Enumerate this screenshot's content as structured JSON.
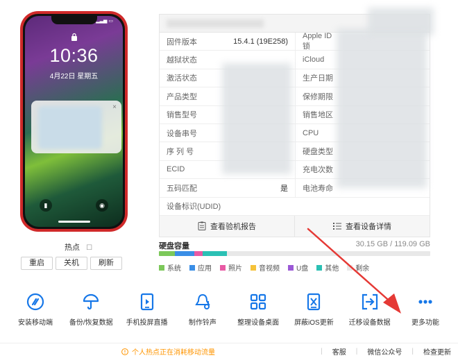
{
  "phone": {
    "time": "10:36",
    "date": "4月22日 星期五",
    "hotspot_label": "热点",
    "buttons": [
      "重启",
      "关机",
      "刷新"
    ]
  },
  "info": {
    "rows": [
      {
        "l1": "固件版本",
        "v1": "15.4.1 (19E258)",
        "l2": "Apple ID锁"
      },
      {
        "l1": "越狱状态",
        "v1": "",
        "l2": "iCloud"
      },
      {
        "l1": "激活状态",
        "v1": "",
        "l2": "生产日期"
      },
      {
        "l1": "产品类型",
        "v1": "",
        "l2": "保修期限"
      },
      {
        "l1": "销售型号",
        "v1": "",
        "l2": "销售地区"
      },
      {
        "l1": "设备串号",
        "v1": "",
        "l2": "CPU"
      },
      {
        "l1": "序 列 号",
        "v1": "",
        "l2": "硬盘类型"
      },
      {
        "l1": "ECID",
        "v1": "",
        "l2": "充电次数"
      },
      {
        "l1": "五码匹配",
        "v1": "是",
        "l2": "电池寿命"
      }
    ],
    "udid_label": "设备标识(UDID)",
    "report_btn": "查看验机报告",
    "detail_btn": "查看设备详情"
  },
  "disk": {
    "title": "硬盘容量",
    "size": "30.15 GB / 119.09 GB",
    "segments": [
      {
        "name": "系统",
        "color": "#7cc85a",
        "fraction": 0.06
      },
      {
        "name": "应用",
        "color": "#3a8ee6",
        "fraction": 0.07
      },
      {
        "name": "照片",
        "color": "#e85aa4",
        "fraction": 0.03
      },
      {
        "name": "音视频",
        "color": "#f5c23a",
        "fraction": 0.0
      },
      {
        "name": "U盘",
        "color": "#9b59d6",
        "fraction": 0.0
      },
      {
        "name": "其他",
        "color": "#2bc0b4",
        "fraction": 0.09
      },
      {
        "name": "剩余",
        "color": "#e8e8e8",
        "fraction": 0.75
      }
    ]
  },
  "tools": [
    {
      "label": "安装移动端",
      "icon": "install-mobile-icon"
    },
    {
      "label": "备份/恢复数据",
      "icon": "umbrella-icon"
    },
    {
      "label": "手机投屏直播",
      "icon": "screen-cast-icon"
    },
    {
      "label": "制作铃声",
      "icon": "bell-icon"
    },
    {
      "label": "整理设备桌面",
      "icon": "grid-icon"
    },
    {
      "label": "屏蔽iOS更新",
      "icon": "block-update-icon"
    },
    {
      "label": "迁移设备数据",
      "icon": "migrate-icon"
    },
    {
      "label": "更多功能",
      "icon": "more-icon"
    }
  ],
  "footer": {
    "note": "个人热点正在消耗移动流量",
    "links": [
      "客服",
      "微信公众号",
      "检查更新"
    ]
  },
  "colors": {
    "accent": "#1677e8",
    "phone_body": "#d02a2a",
    "arrow": "#e53935",
    "warning": "#ff9500"
  }
}
